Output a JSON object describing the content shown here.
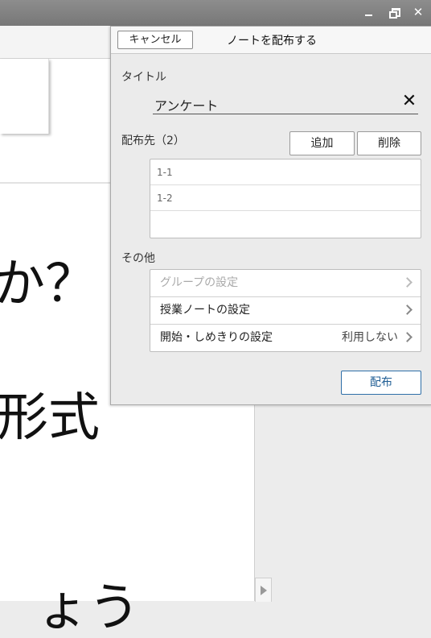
{
  "window": {
    "minimize_icon": "minimize-icon",
    "restore_icon": "restore-icon",
    "close_label": "✕"
  },
  "document": {
    "lines": [
      "か？",
      "形式",
      "ょう"
    ]
  },
  "dialog": {
    "cancel_label": "キャンセル",
    "title": "ノートを配布する",
    "title_section_label": "タイトル",
    "title_value": "アンケート",
    "clear_label": "✕",
    "distribution_label": "配布先（2）",
    "add_label": "追加",
    "delete_label": "削除",
    "recipients": [
      "1-1",
      "1-2"
    ],
    "other_label": "その他",
    "other_items": [
      {
        "label": "グループの設定",
        "value": "",
        "disabled": true
      },
      {
        "label": "授業ノートの設定",
        "value": "",
        "disabled": false
      },
      {
        "label": "開始・しめきりの設定",
        "value": "利用しない",
        "disabled": false
      }
    ],
    "distribute_label": "配布"
  },
  "colors": {
    "accent": "#1f5d94",
    "titlebar": "#808080"
  }
}
